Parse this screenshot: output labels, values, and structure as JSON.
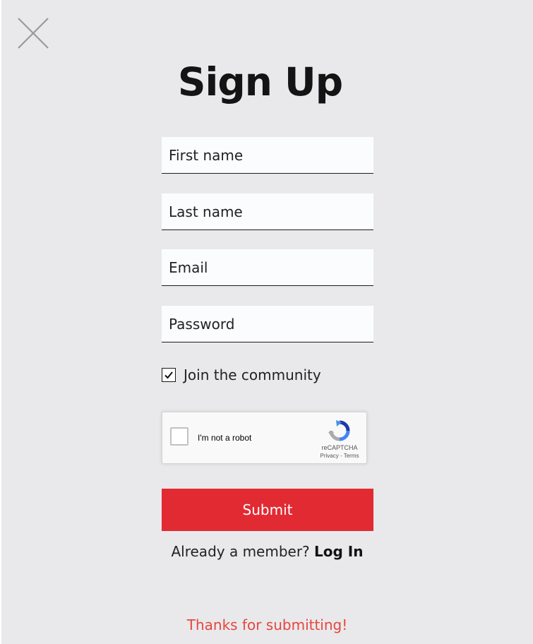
{
  "close_icon": "close-x-icon",
  "title": "Sign Up",
  "fields": {
    "first_name": {
      "placeholder": "First name",
      "value": ""
    },
    "last_name": {
      "placeholder": "Last name",
      "value": ""
    },
    "email": {
      "placeholder": "Email",
      "value": ""
    },
    "password": {
      "placeholder": "Password",
      "value": ""
    }
  },
  "community": {
    "label": "Join the community",
    "checked": true
  },
  "captcha": {
    "label": "I'm not a robot",
    "brand": "reCAPTCHA",
    "links": "Privacy - Terms",
    "icon": "recaptcha-logo-icon"
  },
  "submit_label": "Submit",
  "login_prompt": {
    "text": "Already a member?",
    "link": "Log In"
  },
  "success_message": "Thanks for submitting!",
  "colors": {
    "background": "#e9e9eb",
    "submit": "#e22a33",
    "success_text": "#e8453f",
    "field_bg": "#fbfcfe"
  }
}
